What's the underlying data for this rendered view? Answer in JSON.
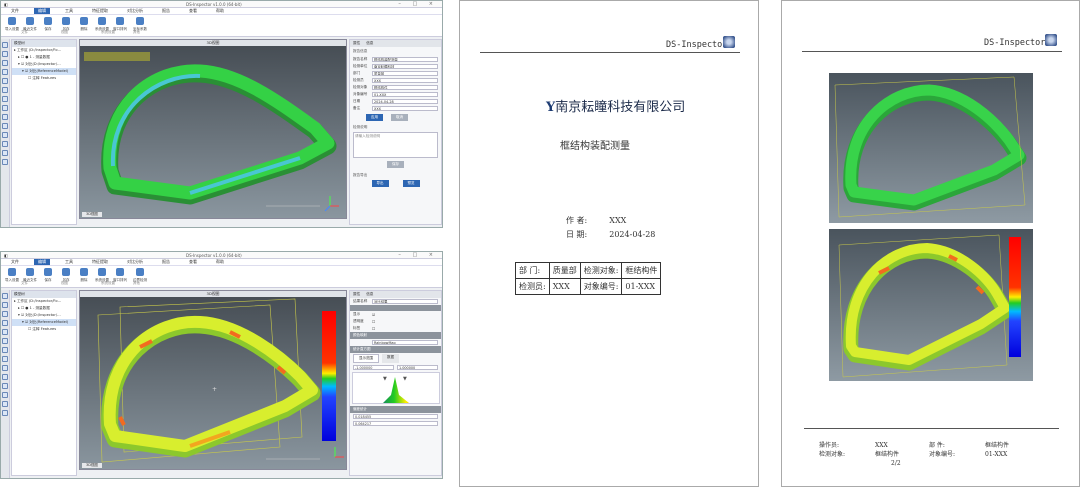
{
  "app": {
    "title": "DS-Inspector v1.0.0 (64-bit)",
    "title2": "DS-Inspector v1.0.0 (64-bit)",
    "window_controls": "– □ ×",
    "menus": [
      "文件",
      "编辑",
      "工具",
      "特征提取",
      "对比分析",
      "报告",
      "查看",
      "帮助"
    ],
    "ribbon": [
      "导入设置",
      "最近文件",
      "保存",
      "另存",
      "删除",
      "系统设置",
      "窗口排列",
      "坐标系数",
      "边界检测"
    ],
    "ribbon_groups": [
      "文件",
      "视图",
      "系统设置",
      "其他"
    ]
  },
  "tree": {
    "header": "模型树",
    "items": [
      "▸ 工作区 (D:/Inspector/Fo…",
      "▸ ☐ ● 1 - 测量数据",
      "▾ ☑ 对比(D:/Inspector/…",
      "▾ ☑ 对比(ReferenceModel)",
      "☐ 注释 Features"
    ]
  },
  "viewport": {
    "header": "3D视图",
    "tab": "3D视图"
  },
  "props1": {
    "tabs": [
      "属性",
      "信息"
    ],
    "section": "报告信息",
    "fields": [
      {
        "label": "报告名称",
        "value": "框结构装配测量"
      },
      {
        "label": "检测单位",
        "value": "南京耘瞳科技"
      },
      {
        "label": "部门",
        "value": "质量部"
      },
      {
        "label": "检测员",
        "value": "XXX"
      },
      {
        "label": "检测对象",
        "value": "框结构件"
      },
      {
        "label": "对象编号",
        "value": "01-XXX"
      },
      {
        "label": "日期",
        "value": "2024-04-28"
      },
      {
        "label": "备注",
        "value": "XXX"
      }
    ],
    "btn_ok": "应用",
    "btn_cancel": "取消",
    "note_title": "检测说明",
    "note": "请输入检测说明",
    "note_btn": "保存",
    "export_title": "报告导出",
    "export_a": "导出",
    "export_b": "预览"
  },
  "props2": {
    "tabs": [
      "属性",
      "信息"
    ],
    "rows": [
      {
        "label": "结果名称",
        "value": "对比结果"
      },
      {
        "label": "显示",
        "value": "☑"
      },
      {
        "label": "透明度",
        "value": "☐"
      },
      {
        "label": "标签",
        "value": "☐"
      }
    ],
    "section_a": "颜色映射",
    "map_name": "RainbowMap",
    "section_b": "统计直方图",
    "hist_tabs": [
      "显示范围",
      "数据"
    ],
    "range_min": "-1.000000",
    "range_max": "1.000000",
    "stats_title": "偏差统计",
    "mean": "0.018455",
    "std": "0.064217"
  },
  "colorbar": {
    "labels": [
      "1.000",
      "0.600",
      "0.250",
      "0.100",
      "-0.100",
      "-0.250",
      "-0.600",
      "-1.000"
    ],
    "colors": [
      "#ff0000",
      "#ff7f00",
      "#ffff00",
      "#22cc22",
      "#22cc22",
      "#00ccff",
      "#2244ff",
      "#0000cc"
    ]
  },
  "doc1": {
    "header": "DS-Inspector",
    "company": "南京耘瞳科技有限公司",
    "title": "框结构装配测量",
    "author_label": "作   者:",
    "author": "XXX",
    "date_label": "日   期:",
    "date": "2024-04-28",
    "table": [
      [
        "部   门:",
        "质量部",
        "检测对象:",
        "框结构件"
      ],
      [
        "检测员:",
        "XXX",
        "对象编号:",
        "01-XXX"
      ]
    ]
  },
  "doc2": {
    "header": "DS-Inspector",
    "footer": [
      [
        "操作员:",
        "XXX",
        "部   件:",
        "框结构件"
      ],
      [
        "检测对象:",
        "框结构件",
        "对象编号:",
        "01-XXX"
      ]
    ],
    "page": "2/2"
  },
  "colors": {
    "accent": "#2d66b3",
    "mesh_green": "#2ecc40",
    "mesh_cyan": "#3ec8d4"
  }
}
